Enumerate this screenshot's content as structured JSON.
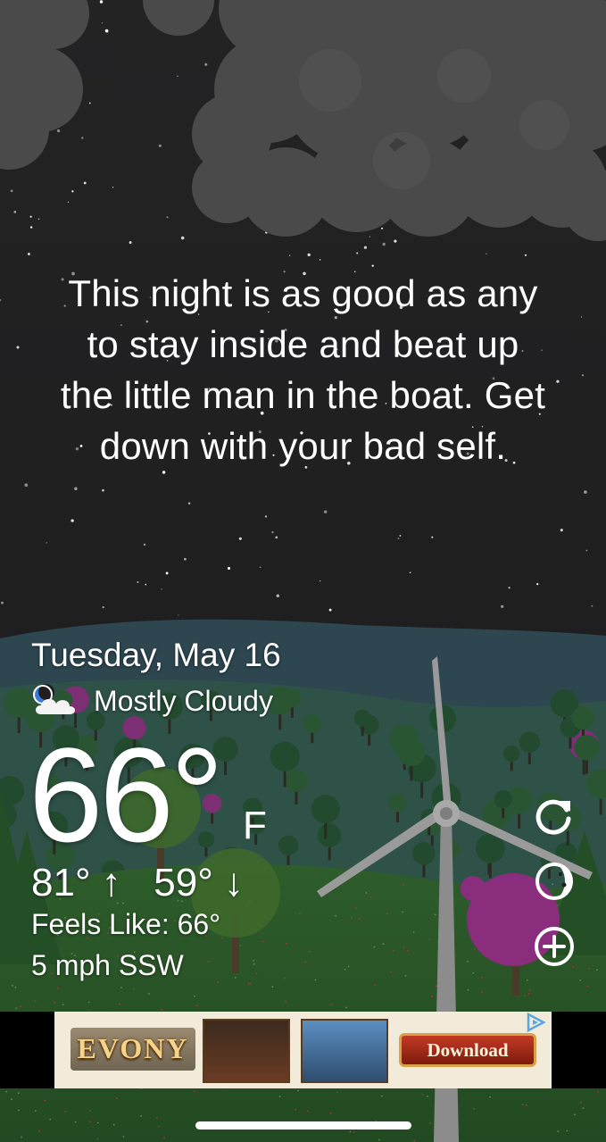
{
  "quote": {
    "lines": [
      "This night is as good as any",
      "to stay inside and beat up",
      "the little man in the boat. Get",
      "down with your bad self."
    ]
  },
  "weather": {
    "date": "Tuesday, May 16",
    "condition": "Mostly Cloudy",
    "condition_icon": "moon-cloud-icon",
    "temperature": "66°",
    "unit": "F",
    "high": "81°",
    "low": "59°",
    "high_arrow": "↑",
    "low_arrow": "↓",
    "feels_like": "Feels Like: 66°",
    "wind": "5 mph SSW"
  },
  "controls": {
    "refresh_icon": "refresh-icon",
    "theme_icon": "moon-phase-icon",
    "add_icon": "add-icon"
  },
  "ad": {
    "brand": "EVONY",
    "cta": "Download",
    "badge_icon": "ad-choices-icon"
  },
  "colors": {
    "sky": "#1f1f20",
    "cloud": "#4a4a4a",
    "hill_far": "#2e4a4f",
    "ground": "#2a5a2a",
    "tree_dark": "#234f2c",
    "tree_purple": "#8a2d7d",
    "text": "#ffffff"
  }
}
